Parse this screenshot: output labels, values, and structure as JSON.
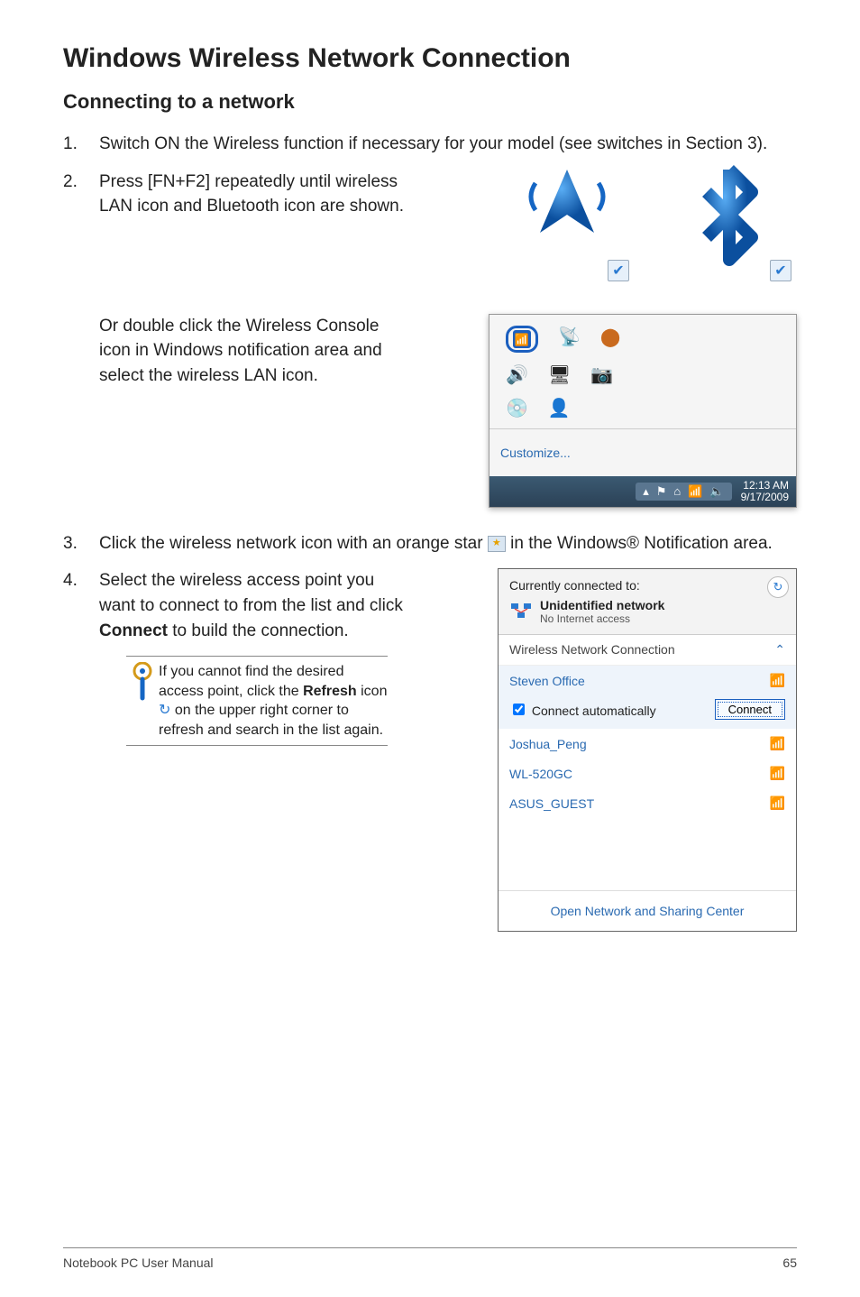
{
  "heading": "Windows Wireless Network Connection",
  "subheading": "Connecting to a network",
  "steps": {
    "s1": {
      "num": "1.",
      "text": "Switch ON the Wireless function if necessary for your model (see switches in Section 3)."
    },
    "s2": {
      "num": "2.",
      "text": "Press [FN+F2] repeatedly until wireless LAN icon and Bluetooth icon are shown."
    },
    "s2b": "Or double click the Wireless Console icon in Windows notification area and select the wireless LAN icon.",
    "s3": {
      "num": "3.",
      "pre": "Click the wireless network icon with an orange star ",
      "post": " in the Windows® Notification area."
    },
    "s4": {
      "num": "4.",
      "pre": "Select the wireless access point you want to connect to from the list and click ",
      "strong": "Connect",
      "post": " to build the connection."
    }
  },
  "callout": {
    "pre": "If you cannot find the desired access point, click the ",
    "strong": "Refresh",
    "mid": " icon ",
    "post": " on the upper right corner to refresh and search in the list again."
  },
  "tray": {
    "customize": "Customize...",
    "time": "12:13 AM",
    "date": "9/17/2009"
  },
  "wifi": {
    "currently": "Currently connected to:",
    "unident": "Unidentified network",
    "noaccess": "No Internet access",
    "section": "Wireless Network Connection",
    "net1": "Steven Office",
    "auto": "Connect automatically",
    "connect": "Connect",
    "net2": "Joshua_Peng",
    "net3": "WL-520GC",
    "net4": "ASUS_GUEST",
    "footer": "Open Network and Sharing Center"
  },
  "footer": {
    "left": "Notebook PC User Manual",
    "right": "65"
  },
  "glyphs": {
    "refresh": "↻"
  }
}
